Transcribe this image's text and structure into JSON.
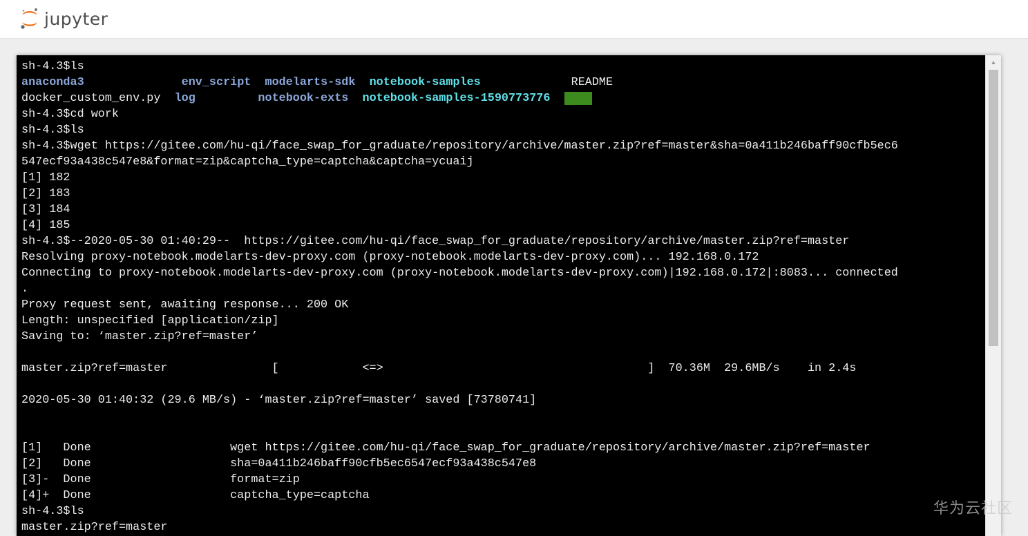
{
  "header": {
    "logo_text": "jupyter",
    "brand_color": "#f37726"
  },
  "terminal": {
    "lines": [
      [
        {
          "t": "sh-4.3$ls"
        }
      ],
      [
        {
          "t": "anaconda3",
          "c": "dir"
        },
        {
          "t": "              "
        },
        {
          "t": "env_script",
          "c": "dir"
        },
        {
          "t": "  "
        },
        {
          "t": "modelarts-sdk",
          "c": "dir"
        },
        {
          "t": "  "
        },
        {
          "t": "notebook-samples",
          "c": "cyan"
        },
        {
          "t": "             README"
        }
      ],
      [
        {
          "t": "docker_custom_env.py  "
        },
        {
          "t": "log",
          "c": "dir"
        },
        {
          "t": "         "
        },
        {
          "t": "notebook-exts",
          "c": "dir"
        },
        {
          "t": "  "
        },
        {
          "t": "notebook-samples-1590773776",
          "c": "cyan"
        },
        {
          "t": "  "
        },
        {
          "t": "work",
          "c": "work"
        }
      ],
      [
        {
          "t": "sh-4.3$cd work"
        }
      ],
      [
        {
          "t": "sh-4.3$ls"
        }
      ],
      [
        {
          "t": "sh-4.3$wget https://gitee.com/hu-qi/face_swap_for_graduate/repository/archive/master.zip?ref=master&sha=0a411b246baff90cfb5ec6"
        }
      ],
      [
        {
          "t": "547ecf93a438c547e8&format=zip&captcha_type=captcha&captcha=ycuaij"
        }
      ],
      [
        {
          "t": "[1] 182"
        }
      ],
      [
        {
          "t": "[2] 183"
        }
      ],
      [
        {
          "t": "[3] 184"
        }
      ],
      [
        {
          "t": "[4] 185"
        }
      ],
      [
        {
          "t": "sh-4.3$--2020-05-30 01:40:29--  https://gitee.com/hu-qi/face_swap_for_graduate/repository/archive/master.zip?ref=master"
        }
      ],
      [
        {
          "t": "Resolving proxy-notebook.modelarts-dev-proxy.com (proxy-notebook.modelarts-dev-proxy.com)... 192.168.0.172"
        }
      ],
      [
        {
          "t": "Connecting to proxy-notebook.modelarts-dev-proxy.com (proxy-notebook.modelarts-dev-proxy.com)|192.168.0.172|:8083... connected"
        }
      ],
      [
        {
          "t": "."
        }
      ],
      [
        {
          "t": "Proxy request sent, awaiting response... 200 OK"
        }
      ],
      [
        {
          "t": "Length: unspecified [application/zip]"
        }
      ],
      [
        {
          "t": "Saving to: ‘master.zip?ref=master’"
        }
      ],
      [
        {
          "t": ""
        }
      ],
      [
        {
          "t": "master.zip?ref=master               [            <=>                                      ]  70.36M  29.6MB/s    in 2.4s"
        }
      ],
      [
        {
          "t": ""
        }
      ],
      [
        {
          "t": "2020-05-30 01:40:32 (29.6 MB/s) - ‘master.zip?ref=master’ saved [73780741]"
        }
      ],
      [
        {
          "t": ""
        }
      ],
      [
        {
          "t": ""
        }
      ],
      [
        {
          "t": "[1]   Done                    wget https://gitee.com/hu-qi/face_swap_for_graduate/repository/archive/master.zip?ref=master"
        }
      ],
      [
        {
          "t": "[2]   Done                    sha=0a411b246baff90cfb5ec6547ecf93a438c547e8"
        }
      ],
      [
        {
          "t": "[3]-  Done                    format=zip"
        }
      ],
      [
        {
          "t": "[4]+  Done                    captcha_type=captcha"
        }
      ],
      [
        {
          "t": "sh-4.3$ls"
        }
      ],
      [
        {
          "t": "master.zip?ref=master"
        }
      ]
    ]
  },
  "watermark": {
    "text": "华为云社区"
  },
  "icons": {
    "logo": "jupyter-logo-icon",
    "scroll_up": "arrow-up-icon"
  }
}
